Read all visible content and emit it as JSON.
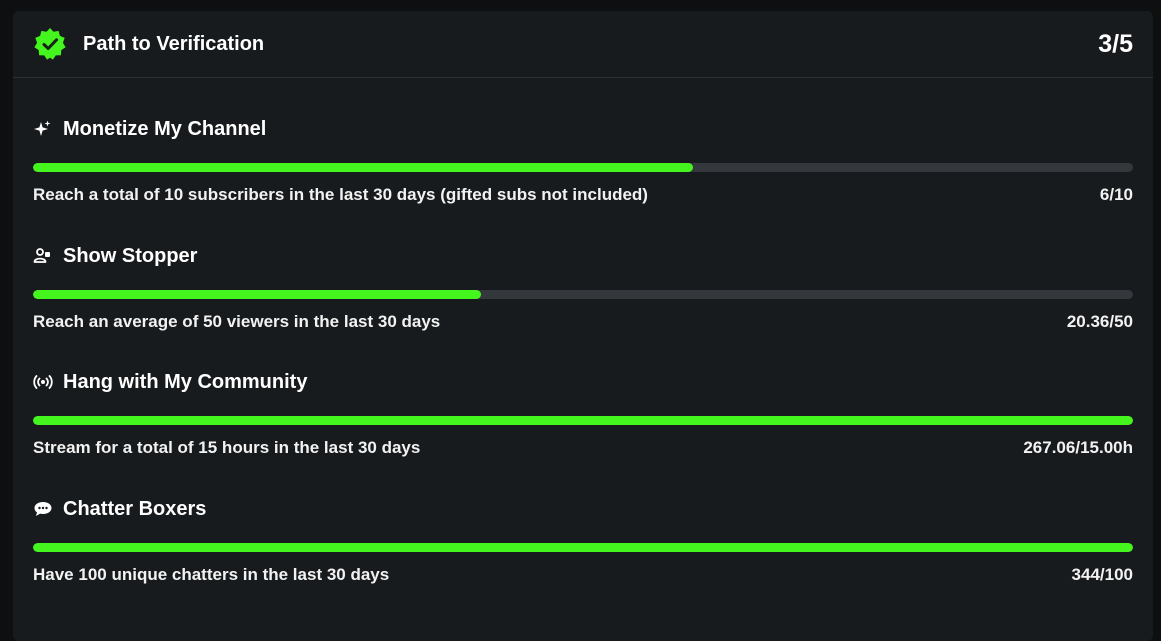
{
  "header": {
    "title": "Path to Verification",
    "progress": "3/5",
    "badge_icon": "verified-badge-icon",
    "accent": "#45f51e"
  },
  "goals": [
    {
      "icon": "sparkle-icon",
      "title": "Monetize My Channel",
      "description": "Reach a total of 10 subscribers in the last 30 days (gifted subs not included)",
      "value": "6/10",
      "progress": 0.6
    },
    {
      "icon": "viewers-icon",
      "title": "Show Stopper",
      "description": "Reach an average of 50 viewers in the last 30 days",
      "value": "20.36/50",
      "progress": 0.407
    },
    {
      "icon": "broadcast-icon",
      "title": "Hang with My Community",
      "description": "Stream for a total of 15 hours in the last 30 days",
      "value": "267.06/15.00h",
      "progress": 1.0
    },
    {
      "icon": "chat-bubble-icon",
      "title": "Chatter Boxers",
      "description": "Have 100 unique chatters in the last 30 days",
      "value": "344/100",
      "progress": 1.0
    }
  ],
  "colors": {
    "background": "#0e0f10",
    "card": "#181b1d",
    "track": "#34373b",
    "fill": "#45f51e"
  }
}
